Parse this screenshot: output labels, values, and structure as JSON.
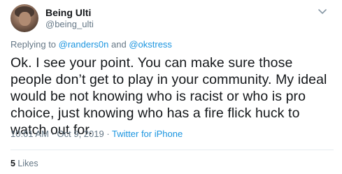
{
  "author": {
    "name": "Being Ulti",
    "handle": "@being_ulti"
  },
  "reply": {
    "prefix": "Replying to ",
    "user1": "@randers0n",
    "joiner": " and ",
    "user2": "@okstress"
  },
  "tweet": {
    "text": "Ok. I see your point. You can make sure those people don’t get to play in your community. My ideal would be not knowing who is racist or who is pro choice, just knowing who has a fire flick huck to watch out for."
  },
  "meta": {
    "time": "10:01 AM",
    "sep1": " · ",
    "date": "Oct 9, 2019",
    "sep2": " · ",
    "source": "Twitter for iPhone"
  },
  "likes": {
    "count": "5",
    "label": " Likes"
  },
  "icons": {
    "caret": "chevron-down-icon"
  },
  "colors": {
    "link": "#1b95e0",
    "secondary": "#657786",
    "primary": "#14171a"
  }
}
